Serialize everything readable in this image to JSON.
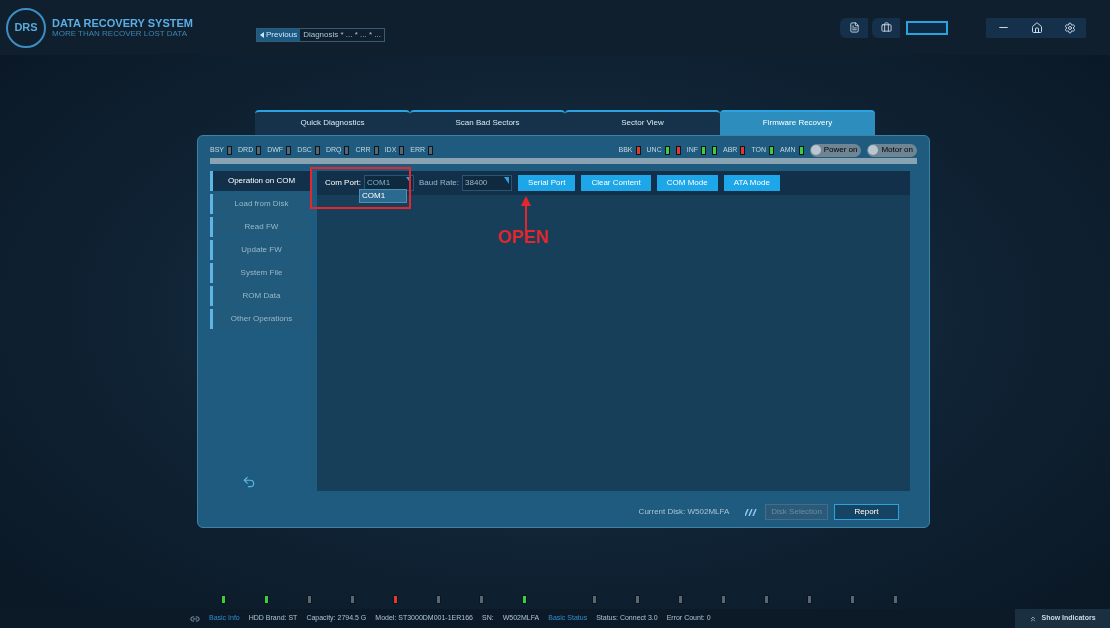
{
  "app": {
    "logo": "DRS",
    "title": "DATA RECOVERY SYSTEM",
    "subtitle": "MORE THAN RECOVER LOST DATA"
  },
  "breadcrumb": {
    "back": "Previous",
    "path": "Diagnosis * ... * ... * ..."
  },
  "tabs": [
    {
      "label": "Quick Diagnostics",
      "selected": false
    },
    {
      "label": "Scan Bad Sectors",
      "selected": false
    },
    {
      "label": "Sector View",
      "selected": false
    },
    {
      "label": "Firmware Recovery",
      "selected": true
    }
  ],
  "indicators_left": [
    {
      "label": "BSY",
      "color": "#5a6670"
    },
    {
      "label": "DRD",
      "color": "#5a6670"
    },
    {
      "label": "DWF",
      "color": "#5a6670"
    },
    {
      "label": "DSC",
      "color": "#5a6670"
    },
    {
      "label": "DRQ",
      "color": "#5a6670"
    },
    {
      "label": "CRR",
      "color": "#5a6670"
    },
    {
      "label": "IDX",
      "color": "#5a6670"
    },
    {
      "label": "ERR",
      "color": "#5a6670"
    }
  ],
  "indicators_right": [
    {
      "label": "BBK",
      "color": "#e03a2e"
    },
    {
      "label": "UNC",
      "color": "#3ccf3c"
    },
    {
      "color": "#e03a2e"
    },
    {
      "label": "INF",
      "color": "#3ccf3c"
    },
    {
      "color": "#3ccf3c"
    },
    {
      "label": "ABR",
      "color": "#e03a2e"
    },
    {
      "label": "TON",
      "color": "#3ccf3c"
    },
    {
      "label": "AMN",
      "color": "#3ccf3c"
    }
  ],
  "toggles": [
    {
      "label": "Power on",
      "on": false
    },
    {
      "label": "Motor on",
      "on": false
    }
  ],
  "nav": [
    {
      "label": "Operation on COM",
      "selected": true
    },
    {
      "label": "Load from Disk",
      "selected": false
    },
    {
      "label": "Read FW",
      "selected": false
    },
    {
      "label": "Update FW",
      "selected": false
    },
    {
      "label": "System File",
      "selected": false
    },
    {
      "label": "ROM Data",
      "selected": false
    },
    {
      "label": "Other Operations",
      "selected": false
    }
  ],
  "com_port": {
    "label": "Com Port:",
    "value": "COM1",
    "options": [
      "COM1"
    ]
  },
  "baud_rate": {
    "label": "Baud Rate:",
    "value": "38400"
  },
  "actions": [
    "Serial Port",
    "Clear Content",
    "COM Mode",
    "ATA Mode"
  ],
  "annotation": "OPEN",
  "footer": {
    "current_disk": "Current Disk: W502MLFA",
    "disk_selection": "Disk Selection",
    "report": "Report"
  },
  "lights": [
    {
      "color": "#3ccf3c"
    },
    {
      "color": "#3ccf3c"
    },
    {
      "color": "#5a6670"
    },
    {
      "color": "#5a6670"
    },
    {
      "color": "#e03a2e"
    },
    {
      "color": "#5a6670"
    },
    {
      "color": "#5a6670"
    },
    {
      "color": "#3ccf3c"
    },
    {
      "color": "#5a6670"
    },
    {
      "color": "#5a6670"
    },
    {
      "color": "#5a6670"
    },
    {
      "color": "#5a6670"
    },
    {
      "color": "#5a6670"
    },
    {
      "color": "#5a6670"
    },
    {
      "color": "#5a6670"
    },
    {
      "color": "#5a6670"
    }
  ],
  "status_bar": [
    {
      "text": "Basic Info",
      "kind": "link"
    },
    {
      "text": "HDD Brand: ST",
      "kind": "text"
    },
    {
      "text": "Capacity: 2794.5 G",
      "kind": "text"
    },
    {
      "text": "Model: ST3000DM001-1ER166",
      "kind": "text"
    },
    {
      "text": "SN:",
      "kind": "text"
    },
    {
      "text": "W502MLFA",
      "kind": "text"
    },
    {
      "text": "Basic Status",
      "kind": "link"
    },
    {
      "text": "Status: Connect 3.0",
      "kind": "text"
    },
    {
      "text": "Error Count: 0",
      "kind": "text"
    }
  ],
  "show_indicators": "Show Indicators"
}
